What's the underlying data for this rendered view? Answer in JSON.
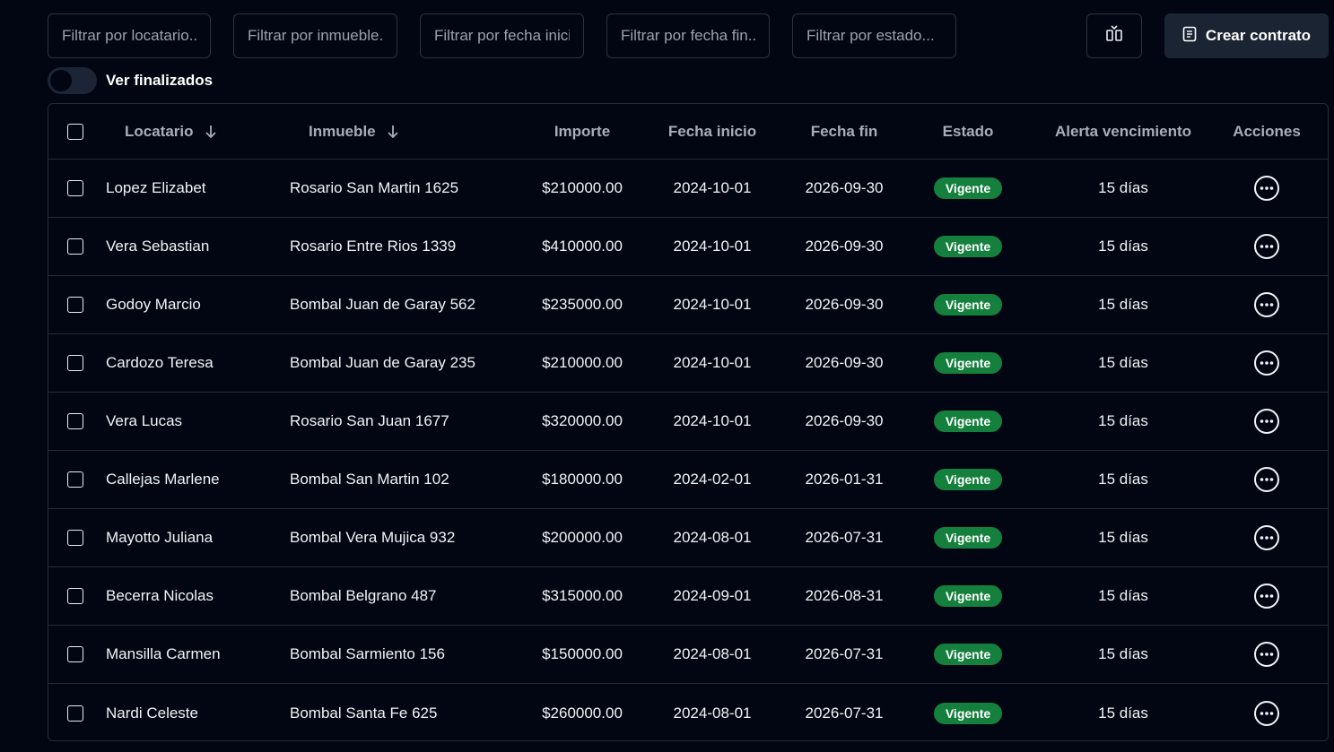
{
  "filters": {
    "locatario_placeholder": "Filtrar por locatario...",
    "inmueble_placeholder": "Filtrar por inmueble...",
    "fecha_inicio_placeholder": "Filtrar por fecha inicio...",
    "fecha_fin_placeholder": "Filtrar por fecha fin...",
    "estado_placeholder": "Filtrar por estado..."
  },
  "toolbar": {
    "columns_icon": "columns-icon",
    "create_icon": "document-icon",
    "create_label": "Crear contrato"
  },
  "toggle": {
    "label": "Ver finalizados",
    "checked": false
  },
  "table": {
    "headers": {
      "locatario": "Locatario",
      "inmueble": "Inmueble",
      "importe": "Importe",
      "fecha_inicio": "Fecha inicio",
      "fecha_fin": "Fecha fin",
      "estado": "Estado",
      "alerta": "Alerta vencimiento",
      "acciones": "Acciones"
    },
    "rows": [
      {
        "locatario": "Lopez Elizabet",
        "inmueble": "Rosario San Martin 1625",
        "importe": "$210000.00",
        "fecha_inicio": "2024-10-01",
        "fecha_fin": "2026-09-30",
        "estado": "Vigente",
        "alerta": "15 días"
      },
      {
        "locatario": "Vera Sebastian",
        "inmueble": "Rosario Entre Rios 1339",
        "importe": "$410000.00",
        "fecha_inicio": "2024-10-01",
        "fecha_fin": "2026-09-30",
        "estado": "Vigente",
        "alerta": "15 días"
      },
      {
        "locatario": "Godoy Marcio",
        "inmueble": "Bombal Juan de Garay 562",
        "importe": "$235000.00",
        "fecha_inicio": "2024-10-01",
        "fecha_fin": "2026-09-30",
        "estado": "Vigente",
        "alerta": "15 días"
      },
      {
        "locatario": "Cardozo Teresa",
        "inmueble": "Bombal Juan de Garay 235",
        "importe": "$210000.00",
        "fecha_inicio": "2024-10-01",
        "fecha_fin": "2026-09-30",
        "estado": "Vigente",
        "alerta": "15 días"
      },
      {
        "locatario": "Vera Lucas",
        "inmueble": "Rosario San Juan 1677",
        "importe": "$320000.00",
        "fecha_inicio": "2024-10-01",
        "fecha_fin": "2026-09-30",
        "estado": "Vigente",
        "alerta": "15 días"
      },
      {
        "locatario": "Callejas Marlene",
        "inmueble": "Bombal San Martin 102",
        "importe": "$180000.00",
        "fecha_inicio": "2024-02-01",
        "fecha_fin": "2026-01-31",
        "estado": "Vigente",
        "alerta": "15 días"
      },
      {
        "locatario": "Mayotto Juliana",
        "inmueble": "Bombal Vera Mujica 932",
        "importe": "$200000.00",
        "fecha_inicio": "2024-08-01",
        "fecha_fin": "2026-07-31",
        "estado": "Vigente",
        "alerta": "15 días"
      },
      {
        "locatario": "Becerra Nicolas",
        "inmueble": "Bombal Belgrano 487",
        "importe": "$315000.00",
        "fecha_inicio": "2024-09-01",
        "fecha_fin": "2026-08-31",
        "estado": "Vigente",
        "alerta": "15 días"
      },
      {
        "locatario": "Mansilla Carmen",
        "inmueble": "Bombal Sarmiento 156",
        "importe": "$150000.00",
        "fecha_inicio": "2024-08-01",
        "fecha_fin": "2026-07-31",
        "estado": "Vigente",
        "alerta": "15 días"
      },
      {
        "locatario": "Nardi Celeste",
        "inmueble": "Bombal Santa Fe 625",
        "importe": "$260000.00",
        "fecha_inicio": "2024-08-01",
        "fecha_fin": "2026-07-31",
        "estado": "Vigente",
        "alerta": "15 días"
      }
    ]
  },
  "colors": {
    "background": "#020612",
    "border": "#2a3140",
    "badge_vigente": "#15803d",
    "primary_button": "#1b2433"
  }
}
